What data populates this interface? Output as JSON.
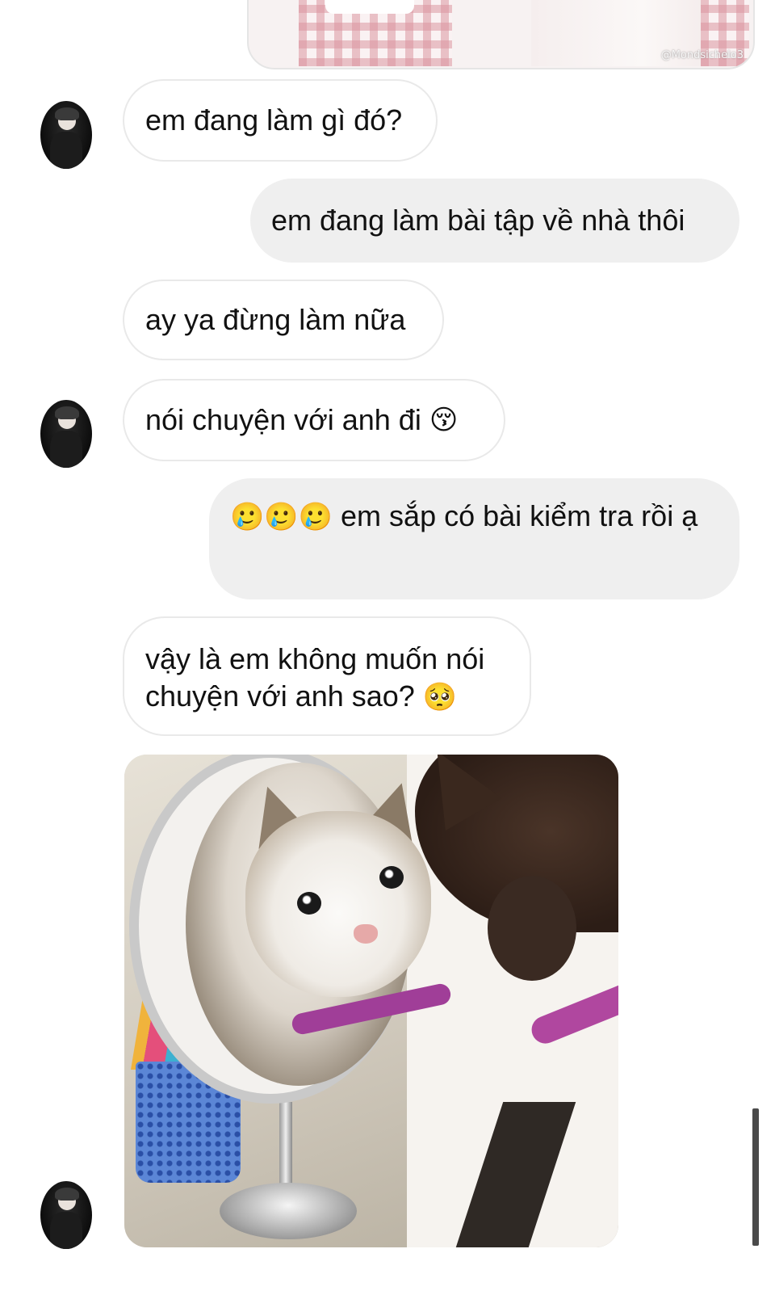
{
  "conversation": {
    "top_image": {
      "watermark": "@Mondsichelo3"
    },
    "messages": [
      {
        "text": "em đang làm gì đó?"
      },
      {
        "text": "em đang làm bài tập về nhà thôi"
      },
      {
        "text": "ay ya đừng làm nữa"
      },
      {
        "text": "nói chuyện với anh đi",
        "emoji": "😚"
      },
      {
        "emoji": "🥲🥲🥲",
        "text": "em sắp có bài kiểm tra rồi ạ"
      },
      {
        "text": "vậy là em không muốn nói chuyện với anh sao?",
        "emoji": "🥺"
      }
    ],
    "sticker": {
      "icon": "crying-cat-mirror-meme"
    }
  },
  "colors": {
    "received_bubble_bg": "#ffffff",
    "received_bubble_border": "#e9e9e9",
    "sent_bubble_bg": "#efefef",
    "text": "#111111"
  }
}
